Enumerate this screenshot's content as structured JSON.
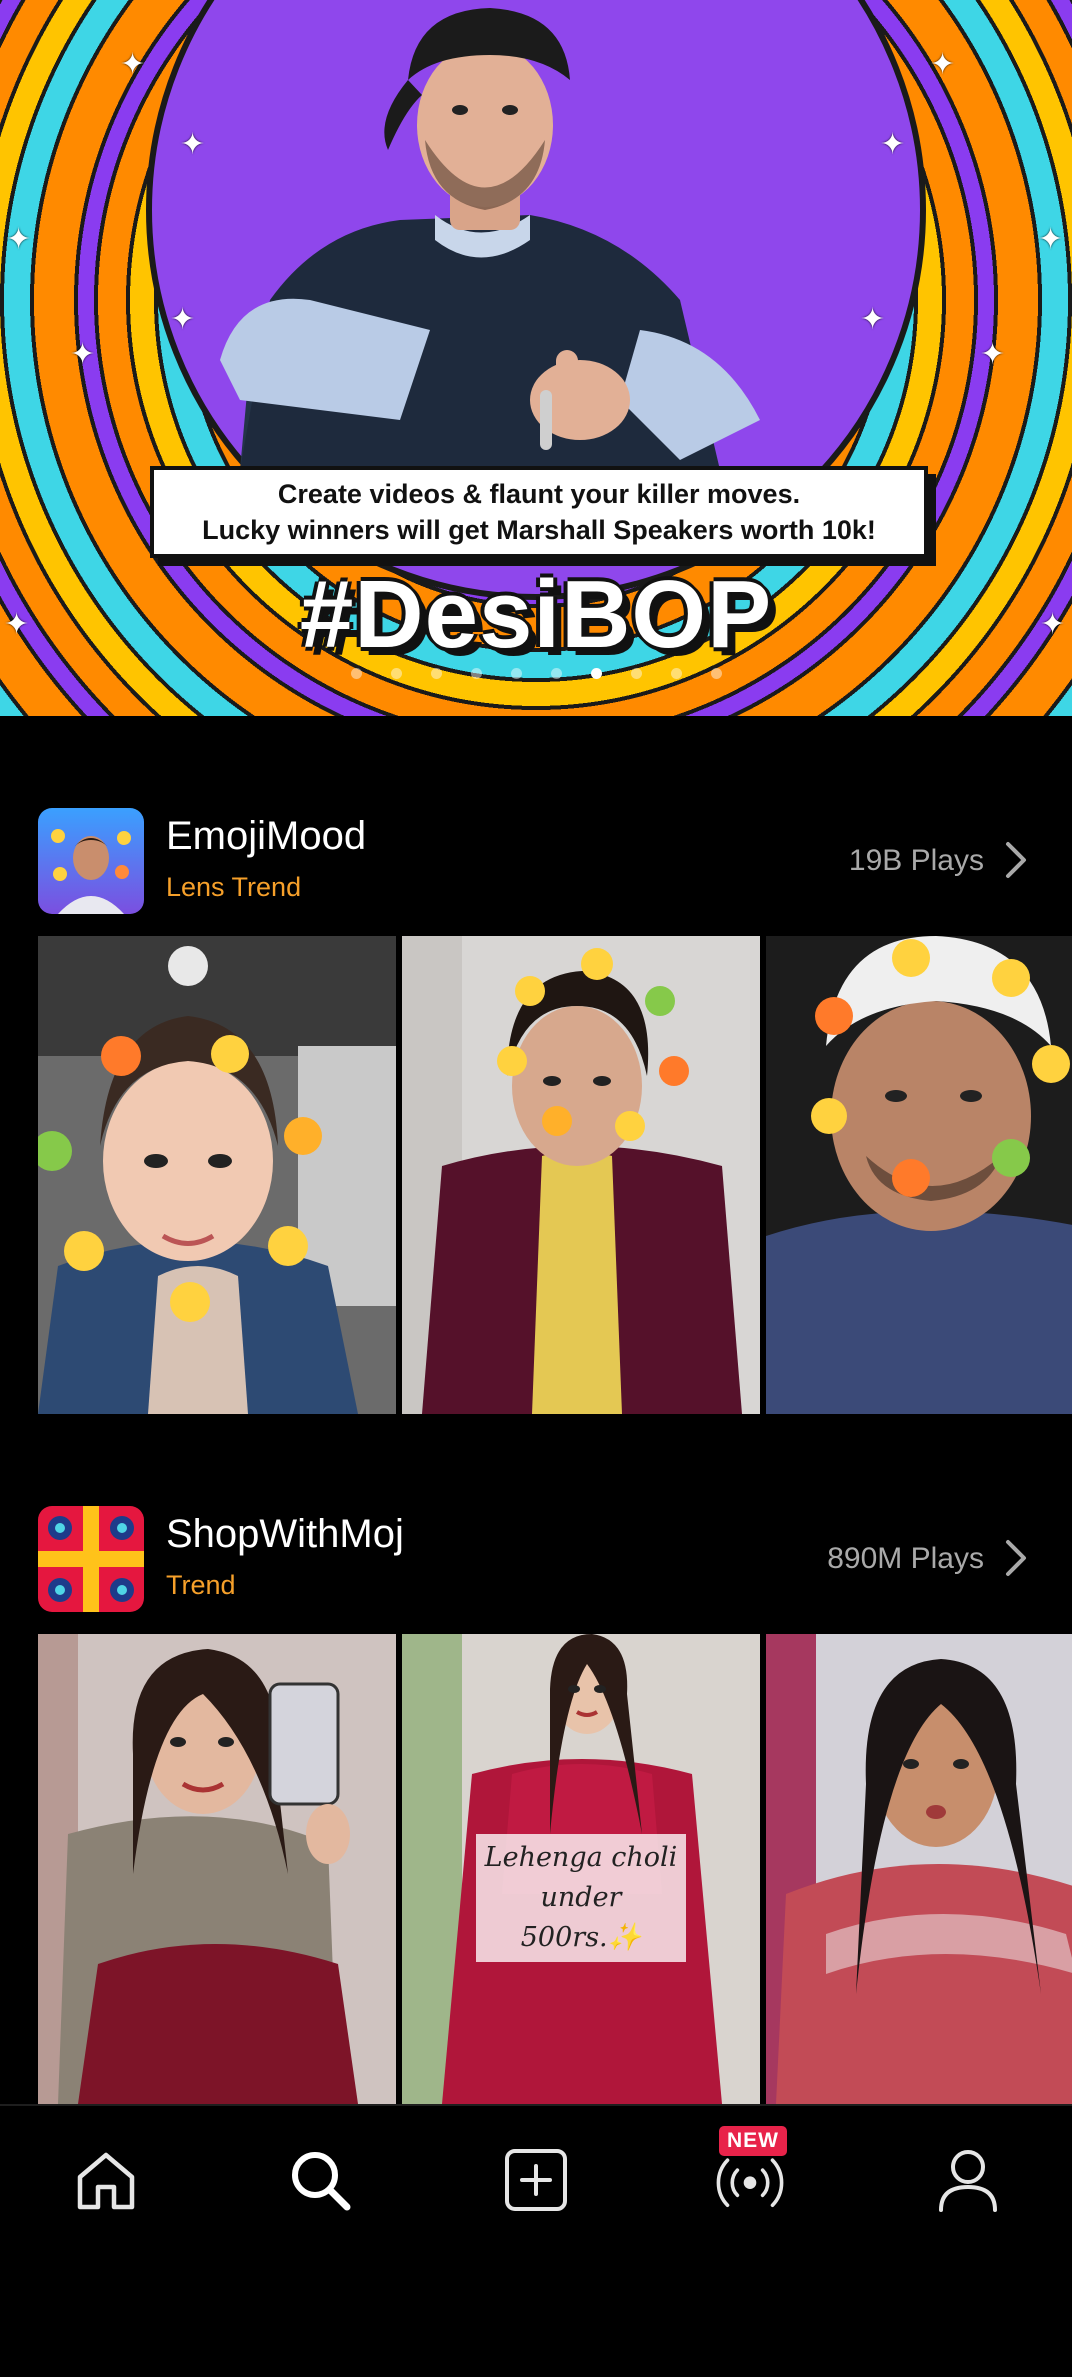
{
  "banner": {
    "line1": "Create videos & flaunt your killer moves.",
    "line2": "Lucky winners will get Marshall Speakers worth 10k!",
    "hashtag": "#DesiBOP",
    "page_count": 10,
    "active_page": 6
  },
  "sections": [
    {
      "title": "EmojiMood",
      "subtitle": "Lens Trend",
      "plays": "19B Plays",
      "tiles": [
        {
          "subject": "girl-with-emoji-lens"
        },
        {
          "subject": "man-with-emoji-lens"
        },
        {
          "subject": "man-with-cap-emoji-lens"
        }
      ]
    },
    {
      "title": "ShopWithMoj",
      "subtitle": "Trend",
      "plays": "890M Plays",
      "tiles": [
        {
          "subject": "woman-selfie-lehenga"
        },
        {
          "subject": "woman-red-lehenga",
          "overlay_line1": "Lehenga choli",
          "overlay_line2": "under 500rs.✨"
        },
        {
          "subject": "woman-red-top"
        }
      ]
    }
  ],
  "nav": {
    "items": [
      {
        "name": "home",
        "icon": "home-icon"
      },
      {
        "name": "search",
        "icon": "search-icon"
      },
      {
        "name": "create",
        "icon": "plus-square-icon"
      },
      {
        "name": "live",
        "icon": "broadcast-icon"
      },
      {
        "name": "profile",
        "icon": "user-icon"
      }
    ],
    "new_badge": "NEW"
  },
  "colors": {
    "background": "#000000",
    "accent_orange": "#f6a02a",
    "badge_red": "#e8234a",
    "banner_purple": "#8f47ec",
    "muted_text": "#a9a9a9"
  }
}
